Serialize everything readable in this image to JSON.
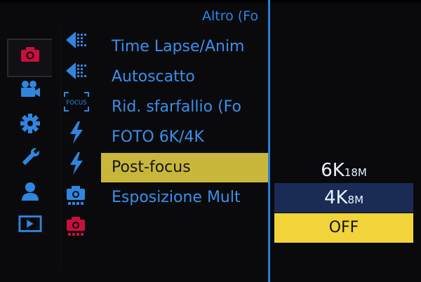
{
  "menu_title": "Altro (Fo",
  "category_tabs": [
    {
      "icon": "camera-icon",
      "active": true,
      "color": "#c8103e"
    },
    {
      "icon": "video-camera-icon",
      "active": false,
      "color": "#2f86e0"
    },
    {
      "icon": "gear-icon",
      "active": false,
      "color": "#2f86e0"
    },
    {
      "icon": "wrench-icon",
      "active": false,
      "color": "#2f86e0"
    },
    {
      "icon": "user-icon",
      "active": false,
      "color": "#2f86e0"
    },
    {
      "icon": "playback-icon",
      "active": false,
      "color": "#2f86e0"
    }
  ],
  "subpage_icons": [
    {
      "icon": "burst-icon",
      "label": ""
    },
    {
      "icon": "burst-icon",
      "label": ""
    },
    {
      "icon": "focus-frame-icon",
      "label": "FOCUS"
    },
    {
      "icon": "flash-icon",
      "label": ""
    },
    {
      "icon": "flash-icon",
      "label": ""
    },
    {
      "icon": "camera-setting-icon",
      "label": ""
    },
    {
      "icon": "camera-setting-icon",
      "label": ""
    }
  ],
  "menu_items": [
    {
      "label": "Time Lapse/Anim",
      "selected": false
    },
    {
      "label": "Autoscatto",
      "selected": false
    },
    {
      "label": "Rid. sfarfallio (Fo",
      "selected": false
    },
    {
      "label": "FOTO 6K/4K",
      "selected": false
    },
    {
      "label": "Post-focus",
      "selected": true
    },
    {
      "label": "Esposizione Mult",
      "selected": false
    }
  ],
  "options": [
    {
      "main": "6K",
      "sub": "18M",
      "state": "normal"
    },
    {
      "main": "4K",
      "sub": "8M",
      "state": "highlight"
    },
    {
      "main": "OFF",
      "sub": "",
      "state": "selected"
    }
  ],
  "colors": {
    "accent_blue": "#2f86e0",
    "selected_yellow": "#f2d43a",
    "menu_highlight": "#c9b73b",
    "active_red": "#c8103e"
  }
}
